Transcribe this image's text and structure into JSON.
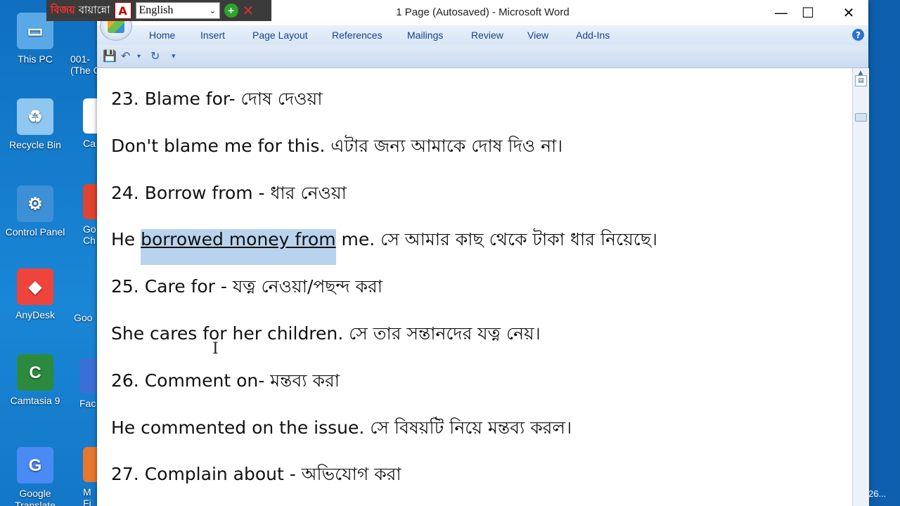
{
  "desktop": {
    "icons": [
      {
        "label": "This PC",
        "icon": "computer-icon",
        "color": "#5aa9e6"
      },
      {
        "label": "Recycle Bin",
        "icon": "recycle-bin-icon",
        "color": "#8fc7f0"
      },
      {
        "label": "Control Panel",
        "icon": "control-panel-icon",
        "color": "#3d8fd6"
      },
      {
        "label": "AnyDesk",
        "icon": "anydesk-icon",
        "color": "#ef443b"
      },
      {
        "label": "Camtasia 9",
        "icon": "camtasia-icon",
        "color": "#2b8a3e"
      },
      {
        "label": "Google Translate",
        "icon": "google-translate-icon",
        "color": "#4a8af4"
      }
    ],
    "peek_icons": [
      {
        "label": "001-\n(The C",
        "icon": "file-icon"
      },
      {
        "label": "Ca",
        "icon": "app-icon"
      },
      {
        "label": "Go\nCh",
        "icon": "chrome-icon"
      },
      {
        "label": "Goo",
        "icon": "chrome-icon"
      },
      {
        "label": "Fac",
        "icon": "facebook-icon"
      },
      {
        "label": "M\nFi",
        "icon": "firefox-icon"
      }
    ],
    "taskbar_peek_text": "26..."
  },
  "langbar": {
    "brand": "বিজয় বায়ান্নো",
    "brand_red": "বিজয়",
    "brand_rest": "বায়ান্নো",
    "language": "English"
  },
  "word": {
    "title": "1 Page (Autosaved) - Microsoft Word",
    "tabs": [
      "Home",
      "Insert",
      "Page Layout",
      "References",
      "Mailings",
      "Review",
      "View",
      "Add-Ins"
    ],
    "lines": [
      {
        "id": "l1",
        "text": "23. Blame for- দোষ দেওয়া"
      },
      {
        "id": "l2",
        "text": "Don't blame me for this. এটার জন্য আমাকে দোষ দিও না।"
      },
      {
        "id": "l3",
        "text": "24. Borrow from - ধার নেওয়া"
      },
      {
        "id": "l4",
        "before": "He ",
        "selected": "borrowed money from",
        "after": " me. সে আমার কাছ থেকে টাকা ধার নিয়েছে।"
      },
      {
        "id": "l5",
        "text": "25. Care for - যত্ন নেওয়া/পছন্দ করা"
      },
      {
        "id": "l6",
        "text": "She cares for her children. সে তার সন্তানদের যত্ন নেয়।"
      },
      {
        "id": "l7",
        "text": "26. Comment on- মন্তব্য করা"
      },
      {
        "id": "l8",
        "text": "He commented on the issue. সে বিষয়টি নিয়ে মন্তব্য করল।"
      },
      {
        "id": "l9",
        "text": "27. Complain about - অভিযোগ করা"
      }
    ]
  }
}
